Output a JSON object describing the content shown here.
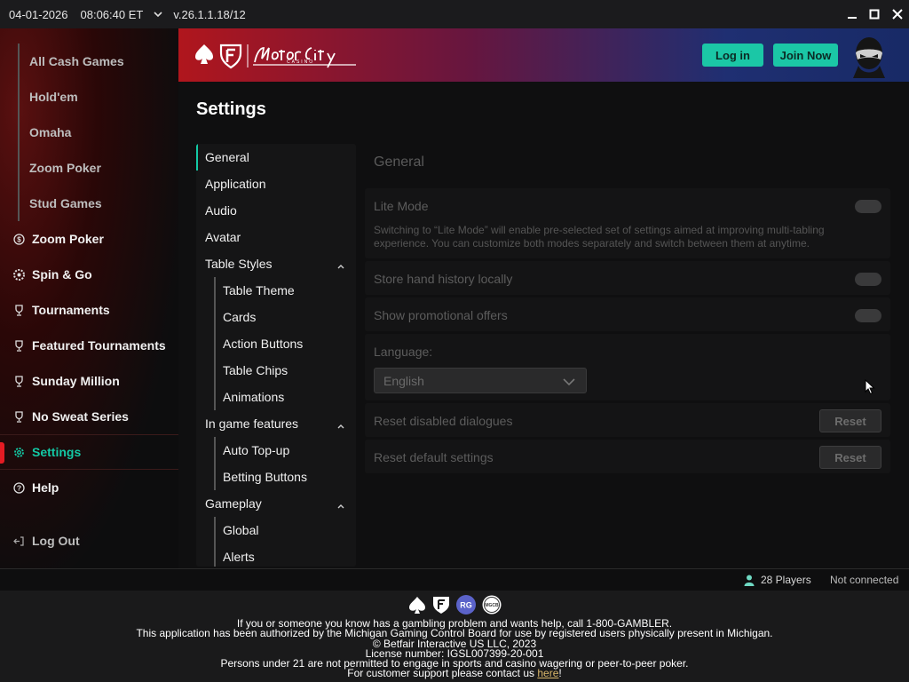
{
  "titlebar": {
    "date": "04-01-2026",
    "time": "08:06:40 ET",
    "version": "v.26.1.1.18/12"
  },
  "sidebar": {
    "sub_items": [
      "All Cash Games",
      "Hold'em",
      "Omaha",
      "Zoom Poker",
      "Stud Games"
    ],
    "items": [
      {
        "label": "Zoom Poker",
        "icon": "zoom-coin-icon"
      },
      {
        "label": "Spin & Go",
        "icon": "spin-icon"
      },
      {
        "label": "Tournaments",
        "icon": "trophy-icon"
      },
      {
        "label": "Featured Tournaments",
        "icon": "trophy-icon"
      },
      {
        "label": "Sunday Million",
        "icon": "trophy-icon"
      },
      {
        "label": "No Sweat Series",
        "icon": "trophy-icon"
      },
      {
        "label": "Settings",
        "icon": "gear-icon"
      },
      {
        "label": "Help",
        "icon": "help-icon"
      },
      {
        "label": "Log Out",
        "icon": "logout-icon"
      }
    ]
  },
  "header": {
    "login_label": "Log in",
    "join_label": "Join Now"
  },
  "main": {
    "title": "Settings",
    "nav": {
      "general": "General",
      "application": "Application",
      "audio": "Audio",
      "avatar": "Avatar",
      "table_styles": "Table Styles",
      "table_styles_items": [
        "Table Theme",
        "Cards",
        "Action Buttons",
        "Table Chips",
        "Animations"
      ],
      "in_game": "In game features",
      "in_game_items": [
        "Auto Top-up",
        "Betting Buttons"
      ],
      "gameplay": "Gameplay",
      "gameplay_items": [
        "Global",
        "Alerts"
      ]
    },
    "content": {
      "section": "General",
      "lite_mode": "Lite Mode",
      "lite_desc": "Switching to “Lite Mode” will enable pre-selected set of settings aimed at improving multi-tabling experience. You can customize both modes separately and switch between them at anytime.",
      "store_history": "Store hand history locally",
      "promo": "Show promotional offers",
      "language_label": "Language:",
      "language_value": "English",
      "reset_dialogues": "Reset disabled dialogues",
      "reset_defaults": "Reset default settings",
      "reset_label": "Reset"
    }
  },
  "statusbar": {
    "players": "28 Players",
    "connection": "Not connected"
  },
  "footer": {
    "line1": "If you or someone you know has a gambling problem and wants help, call 1-800-GAMBLER.",
    "line2": "This application has been authorized by the Michigan Gaming Control Board for use by registered users physically present in Michigan.",
    "line3": "© Betfair Interactive US LLC, 2023",
    "line4": "License number: IGSL007399-20-001",
    "line5": "Persons under 21 are not permitted to engage in sports and casino wagering or peer-to-peer poker.",
    "line6_pre": "For customer support please contact us ",
    "line6_link": "here",
    "line6_post": "!",
    "badges": [
      "RG",
      "MGCB"
    ]
  },
  "colors": {
    "accent": "#13c9a5",
    "active_marker": "#e31b23",
    "button": "#1bc7a6"
  }
}
